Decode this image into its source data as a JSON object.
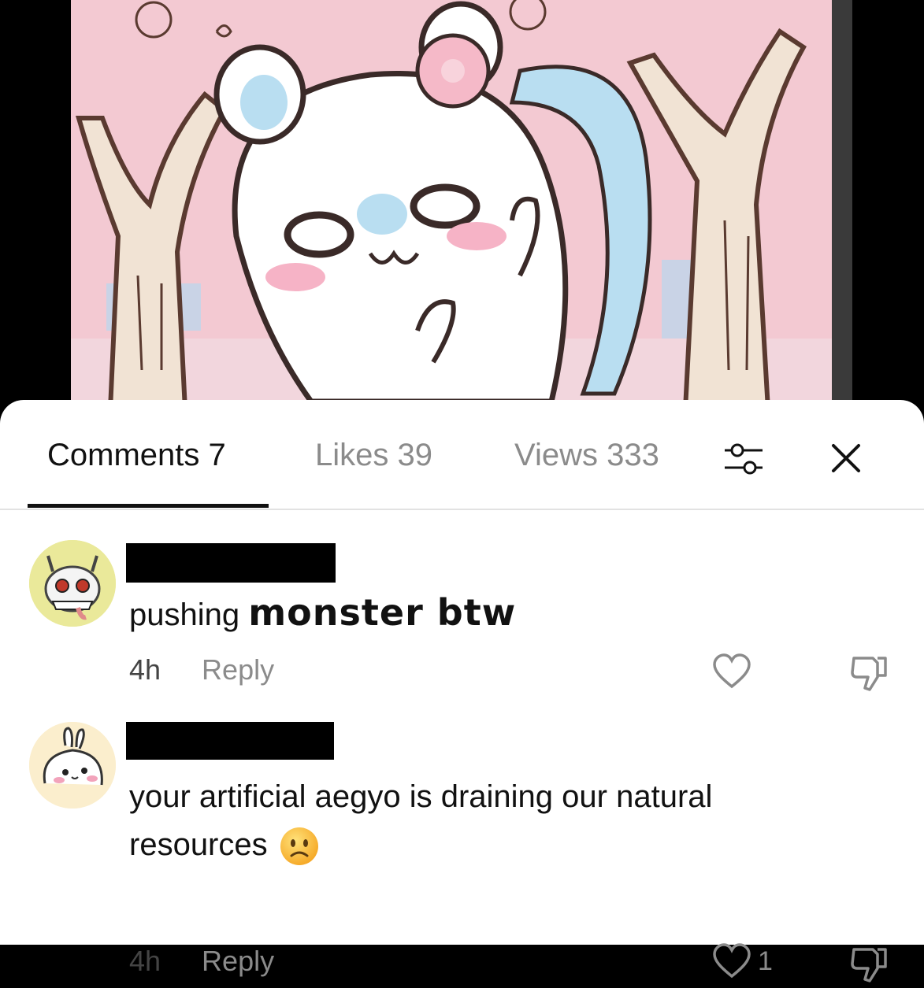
{
  "tabs": [
    {
      "label": "Comments 7",
      "active": true
    },
    {
      "label": "Likes 39",
      "active": false
    },
    {
      "label": "Views 333",
      "active": false
    }
  ],
  "icons": {
    "filter": "sliders-icon",
    "close": "close-icon",
    "like": "heart-outline-icon",
    "dislike": "thumbs-down-icon",
    "emoji": "frowning-face-emoji"
  },
  "comments": [
    {
      "text_regular": "pushing ",
      "text_bold": "monster btw",
      "time": "4h",
      "reply_label": "Reply",
      "like_count": ""
    },
    {
      "text_line1": "your artificial aegyo is draining our natural",
      "text_line2": "resources",
      "time": "4h",
      "reply_label": "Reply",
      "like_count": "1"
    }
  ],
  "colors": {
    "active_tab": "#111111",
    "inactive_tab": "#8b8b8b",
    "illustration_pink": "#f3c9d2",
    "illustration_blue": "#b9def1"
  }
}
